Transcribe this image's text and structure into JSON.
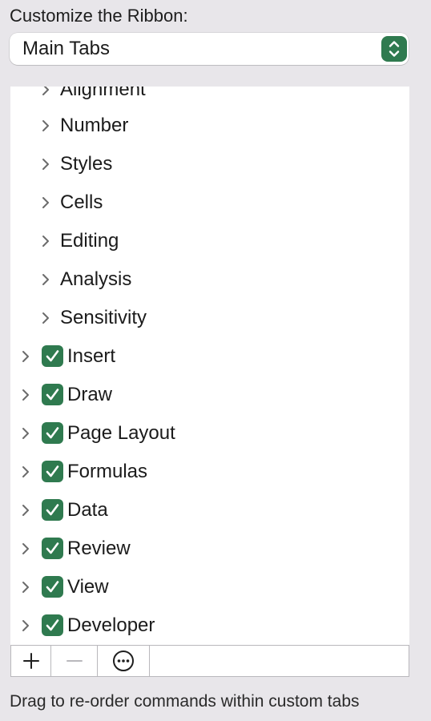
{
  "heading": "Customize the Ribbon:",
  "select": {
    "value": "Main Tabs",
    "icon": "up-down-arrows-icon",
    "accent": "#2f7a4f"
  },
  "tree": {
    "children_of_expanded": [
      "Alignment",
      "Number",
      "Styles",
      "Cells",
      "Editing",
      "Analysis",
      "Sensitivity"
    ],
    "tabs": [
      {
        "label": "Insert",
        "checked": true
      },
      {
        "label": "Draw",
        "checked": true
      },
      {
        "label": "Page Layout",
        "checked": true
      },
      {
        "label": "Formulas",
        "checked": true
      },
      {
        "label": "Data",
        "checked": true
      },
      {
        "label": "Review",
        "checked": true
      },
      {
        "label": "View",
        "checked": true
      },
      {
        "label": "Developer",
        "checked": true
      }
    ]
  },
  "toolbar": {
    "add_icon": "plus-icon",
    "remove_icon": "minus-icon",
    "more_icon": "ellipsis-circle-icon"
  },
  "footer": "Drag to re-order commands within custom tabs"
}
